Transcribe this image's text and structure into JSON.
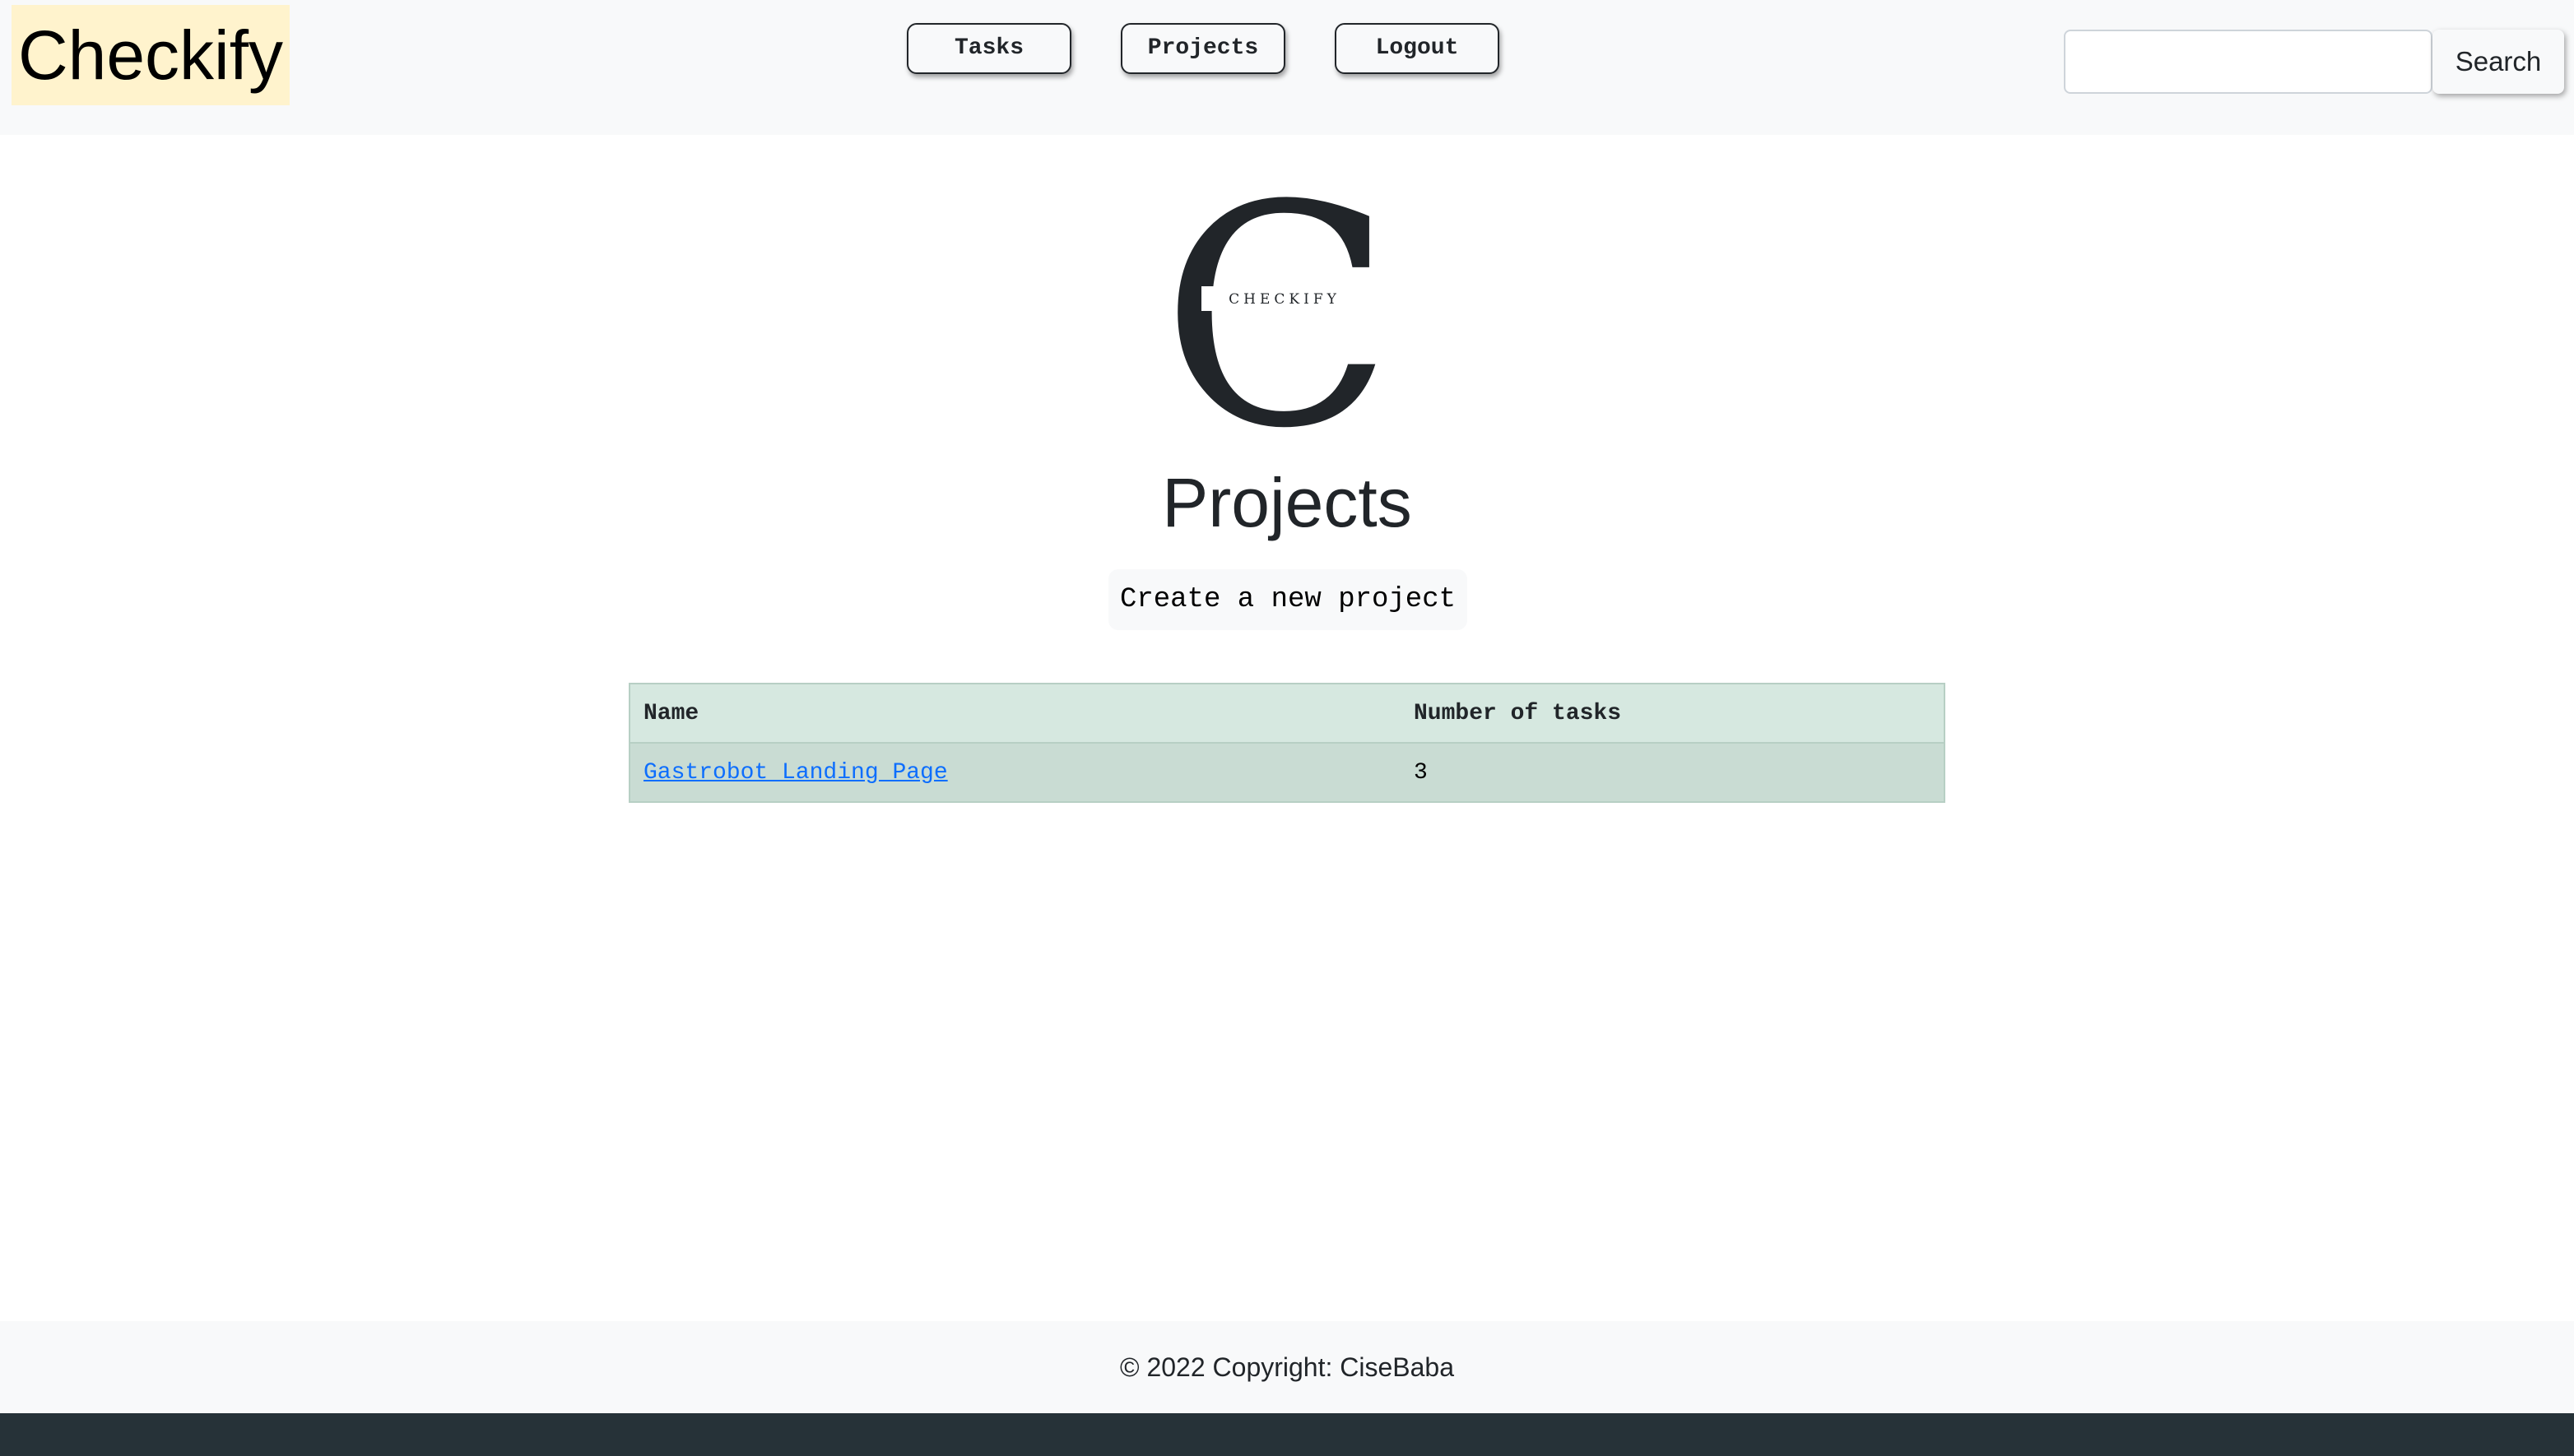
{
  "header": {
    "brand": "Checkify",
    "nav": {
      "tasks_label": "Tasks",
      "projects_label": "Projects",
      "logout_label": "Logout"
    },
    "search": {
      "value": "",
      "placeholder": "",
      "button_label": "Search"
    }
  },
  "logo": {
    "letter": "C",
    "wordmark": "CHECKIFY"
  },
  "main": {
    "title": "Projects",
    "create_button_label": "Create a new project",
    "table": {
      "columns": [
        "Name",
        "Number of tasks"
      ],
      "rows": [
        {
          "name": "Gastrobot Landing Page",
          "tasks": "3"
        }
      ]
    }
  },
  "footer": {
    "text": "© 2022 Copyright: CiseBaba"
  },
  "colors": {
    "brand_bg": "#fff3cd",
    "navbar_bg": "#f8f9fa",
    "table_header_bg": "#d6e8e0",
    "table_row_bg": "#c9dcd3",
    "link": "#0d6efd",
    "bottom_bar": "#263238"
  }
}
